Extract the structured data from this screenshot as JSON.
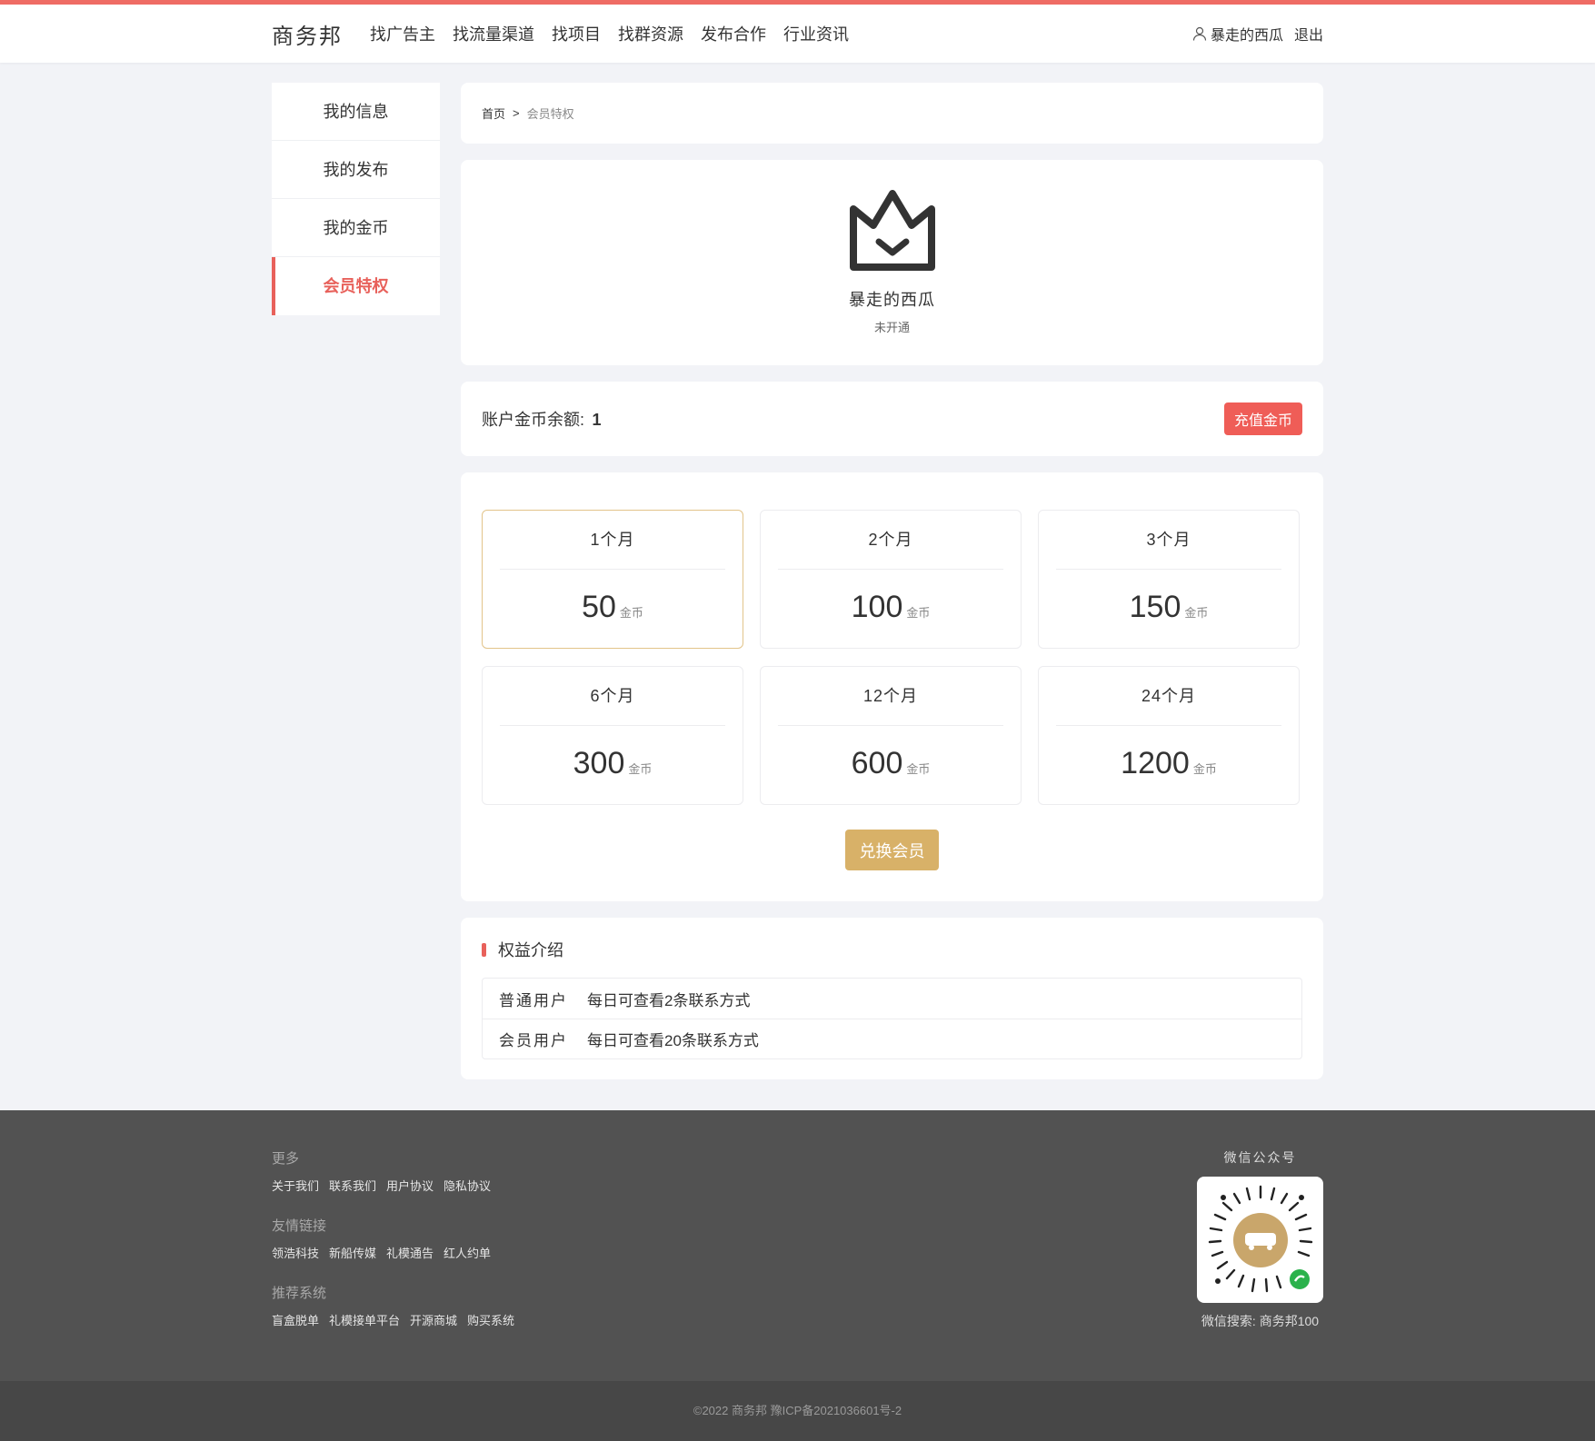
{
  "header": {
    "logo": "商务邦",
    "nav": [
      "找广告主",
      "找流量渠道",
      "找项目",
      "找群资源",
      "发布合作",
      "行业资讯"
    ],
    "user_name": "暴走的西瓜",
    "logout": "退出"
  },
  "sidebar": {
    "items": [
      {
        "label": "我的信息"
      },
      {
        "label": "我的发布"
      },
      {
        "label": "我的金币"
      },
      {
        "label": "会员特权"
      }
    ]
  },
  "breadcrumb": {
    "home": "首页",
    "separator": ">",
    "current": "会员特权"
  },
  "profile": {
    "name": "暴走的西瓜",
    "status": "未开通",
    "icon": "crown-icon"
  },
  "balance": {
    "label": "账户金币余额:",
    "value": "1",
    "button": "充值金币"
  },
  "plans": [
    {
      "period": "1个月",
      "amount": "50",
      "unit": "金币"
    },
    {
      "period": "2个月",
      "amount": "100",
      "unit": "金币"
    },
    {
      "period": "3个月",
      "amount": "150",
      "unit": "金币"
    },
    {
      "period": "6个月",
      "amount": "300",
      "unit": "金币"
    },
    {
      "period": "12个月",
      "amount": "600",
      "unit": "金币"
    },
    {
      "period": "24个月",
      "amount": "1200",
      "unit": "金币"
    }
  ],
  "exchange_button": "兑换会员",
  "benefits": {
    "title": "权益介绍",
    "rows": [
      {
        "type": "普通用户",
        "desc": "每日可查看2条联系方式"
      },
      {
        "type": "会员用户",
        "desc": "每日可查看20条联系方式"
      }
    ]
  },
  "footer": {
    "groups": [
      {
        "title": "更多",
        "links": [
          "关于我们",
          "联系我们",
          "用户协议",
          "隐私协议"
        ]
      },
      {
        "title": "友情链接",
        "links": [
          "领浩科技",
          "新船传媒",
          "礼模通告",
          "红人约单"
        ]
      },
      {
        "title": "推荐系统",
        "links": [
          "盲盒脱单",
          "礼模接单平台",
          "开源商城",
          "购买系统"
        ]
      }
    ],
    "qr_title": "微信公众号",
    "qr_caption": "微信搜索: 商务邦100",
    "copyright": "©2022 商务邦 豫ICP备2021036601号-2"
  },
  "colors": {
    "accent": "#e8615b",
    "gold": "#d8b168",
    "footer_bg": "#525252"
  }
}
